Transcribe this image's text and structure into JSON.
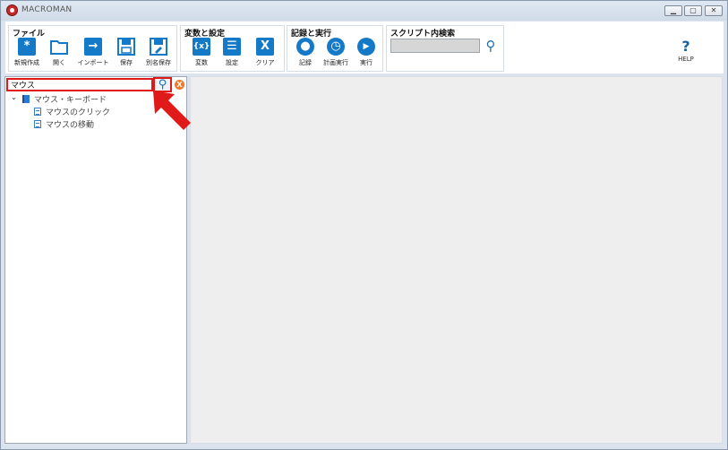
{
  "window": {
    "title": "MACROMAN",
    "controls": {
      "minimize": "▁",
      "maximize": "▢",
      "close": "✕"
    }
  },
  "ribbon": {
    "file_group": {
      "title": "ファイル",
      "tools": [
        {
          "icon": "asterisk-icon",
          "glyph": "*",
          "label": "新規作成"
        },
        {
          "icon": "folder-icon",
          "glyph": "",
          "label": "開く"
        },
        {
          "icon": "import-arrow-icon",
          "glyph": "→",
          "label": "インポート"
        },
        {
          "icon": "save-icon",
          "glyph": "",
          "label": "保存"
        },
        {
          "icon": "save-as-icon",
          "glyph": "",
          "label": "別名保存"
        }
      ]
    },
    "vars_group": {
      "title": "変数と設定",
      "tools": [
        {
          "icon": "variable-icon",
          "glyph": "{x}",
          "label": "変数"
        },
        {
          "icon": "settings-list-icon",
          "glyph": "☰",
          "label": "設定"
        },
        {
          "icon": "clear-x-icon",
          "glyph": "X",
          "label": "クリア"
        }
      ]
    },
    "run_group": {
      "title": "記録と実行",
      "tools": [
        {
          "icon": "record-icon",
          "glyph": "●",
          "label": "記録"
        },
        {
          "icon": "scheduled-run-icon",
          "glyph": "◷",
          "label": "計画実行"
        },
        {
          "icon": "play-icon",
          "glyph": "▶",
          "label": "実行"
        }
      ]
    },
    "script_search_group": {
      "title": "スクリプト内検索",
      "input_value": "",
      "search_glyph": "⚲"
    },
    "help": {
      "glyph": "?",
      "label": "HELP"
    }
  },
  "left_panel": {
    "search": {
      "value": "マウス",
      "search_glyph": "⚲",
      "clear_glyph": "X"
    },
    "tree": {
      "caret": "⌄",
      "category": "マウス・キーボード",
      "items": [
        "マウスのクリック",
        "マウスの移動"
      ]
    }
  },
  "colors": {
    "accent": "#1479c6",
    "highlight_red": "#e01919",
    "clear_orange": "#f07a2a",
    "frame": "#dbe4ee"
  }
}
